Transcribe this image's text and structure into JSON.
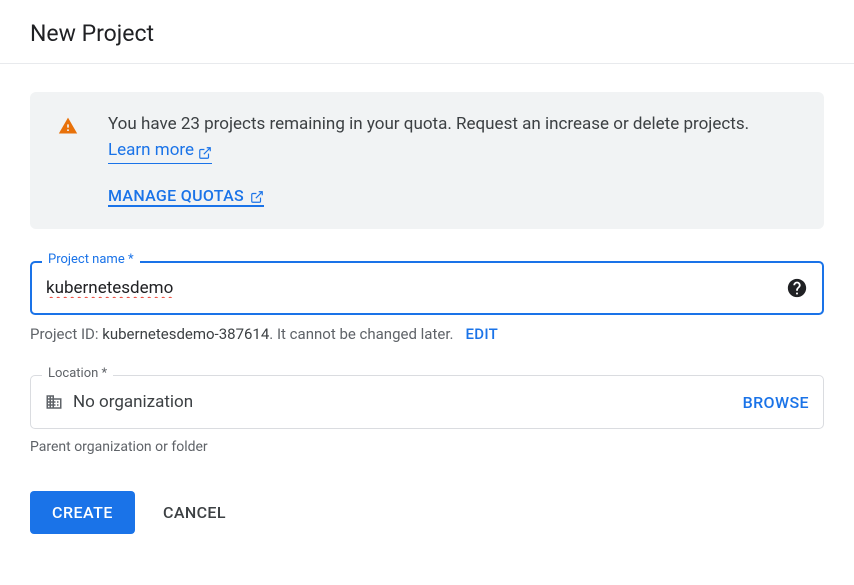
{
  "header": {
    "title": "New Project"
  },
  "quota": {
    "message_prefix": "You have ",
    "remaining_count": "23",
    "message_suffix": " projects remaining in your quota. Request an increase or delete projects. ",
    "learn_more_label": "Learn more",
    "manage_quotas_label": "MANAGE QUOTAS"
  },
  "project_name": {
    "label": "Project name *",
    "value": "kubernetesdemo"
  },
  "project_id": {
    "prefix": "Project ID: ",
    "value": "kubernetesdemo-387614",
    "suffix": ". It cannot be changed later.",
    "edit_label": "EDIT"
  },
  "location": {
    "label": "Location *",
    "value": "No organization",
    "browse_label": "BROWSE",
    "helper": "Parent organization or folder"
  },
  "actions": {
    "create_label": "CREATE",
    "cancel_label": "CANCEL"
  }
}
